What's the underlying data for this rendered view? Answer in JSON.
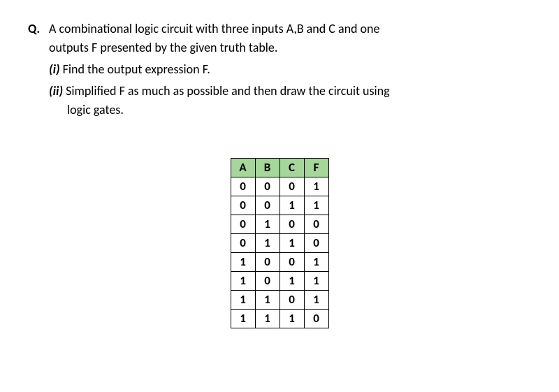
{
  "question": {
    "marker": "Q.",
    "intro_line1": "A combinational logic circuit with three inputs A,B and C and one",
    "intro_line2": "outputs F  presented by the given truth table.",
    "parts": {
      "i": {
        "marker": "(i)",
        "text": "Find the output expression F."
      },
      "ii": {
        "marker": "(ii)",
        "text_line1": "Simplified F as much as possible and then draw the circuit using",
        "text_line2": "logic gates."
      }
    }
  },
  "chart_data": {
    "type": "table",
    "title": "Truth table",
    "headers": [
      "A",
      "B",
      "C",
      "F"
    ],
    "rows": [
      [
        "0",
        "0",
        "0",
        "1"
      ],
      [
        "0",
        "0",
        "1",
        "1"
      ],
      [
        "0",
        "1",
        "0",
        "0"
      ],
      [
        "0",
        "1",
        "1",
        "0"
      ],
      [
        "1",
        "0",
        "0",
        "1"
      ],
      [
        "1",
        "0",
        "1",
        "1"
      ],
      [
        "1",
        "1",
        "0",
        "1"
      ],
      [
        "1",
        "1",
        "1",
        "0"
      ]
    ]
  }
}
